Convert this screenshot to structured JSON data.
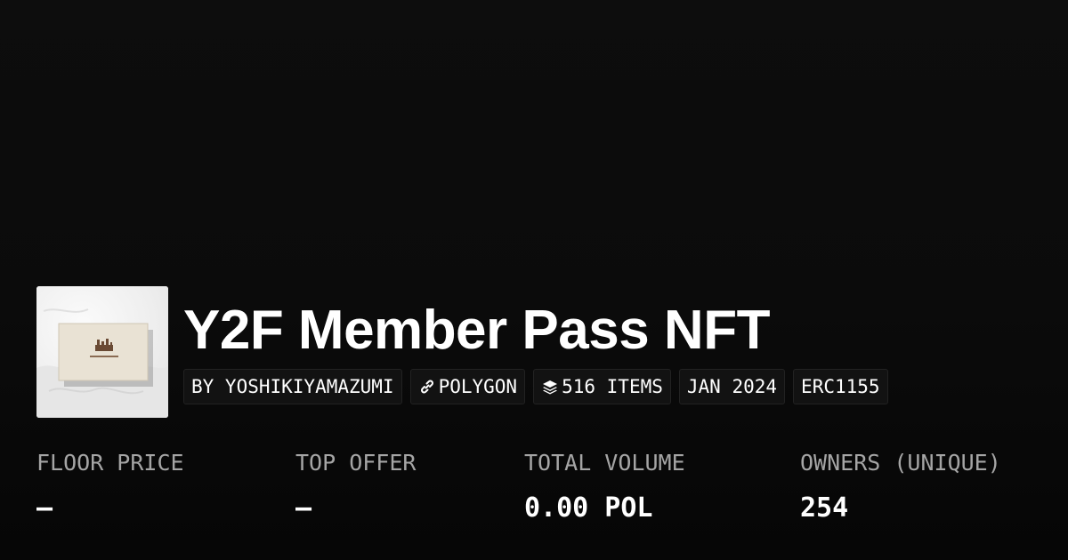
{
  "collection": {
    "title": "Y2F Member Pass NFT",
    "image_alt": "Y2F Member Pass card",
    "badges": {
      "creator": "BY YOSHIKIYAMAZUMI",
      "chain": "POLYGON",
      "items": "516 ITEMS",
      "date": "JAN 2024",
      "standard": "ERC1155"
    }
  },
  "stats": {
    "floor_price": {
      "label": "FLOOR PRICE",
      "value": "–"
    },
    "top_offer": {
      "label": "TOP OFFER",
      "value": "–"
    },
    "total_volume": {
      "label": "TOTAL VOLUME",
      "value": "0.00 POL"
    },
    "owners": {
      "label": "OWNERS (UNIQUE)",
      "value": "254"
    }
  },
  "icons": {
    "chain": "link-icon",
    "items": "layers-icon"
  },
  "colors": {
    "background": "#0b0b0b",
    "text": "#ffffff",
    "muted": "#a5a5a5",
    "badge_bg": "#121212"
  }
}
